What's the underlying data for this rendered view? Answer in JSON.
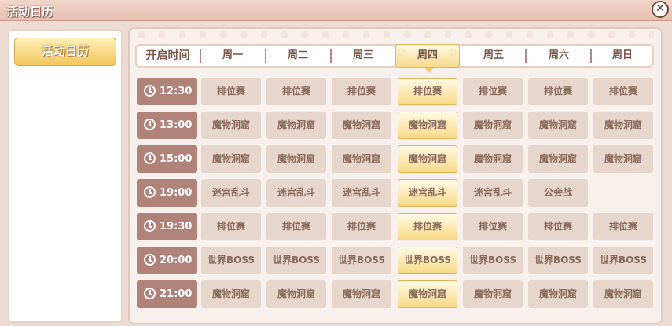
{
  "window": {
    "title": "活动日历",
    "close_symbol": "✕"
  },
  "sidebar": {
    "items": [
      {
        "label": "活动日历",
        "active": true
      }
    ]
  },
  "header": {
    "time_label": "开启时间",
    "days": [
      "周一",
      "周二",
      "周三",
      "周四",
      "周五",
      "周六",
      "周日"
    ],
    "active_day_index": 3
  },
  "schedule": [
    {
      "time": "12:30",
      "events": [
        "排位赛",
        "排位赛",
        "排位赛",
        "排位赛",
        "排位赛",
        "排位赛",
        "排位赛"
      ]
    },
    {
      "time": "13:00",
      "events": [
        "魔物洞窟",
        "魔物洞窟",
        "魔物洞窟",
        "魔物洞窟",
        "魔物洞窟",
        "魔物洞窟",
        "魔物洞窟"
      ]
    },
    {
      "time": "15:00",
      "events": [
        "魔物洞窟",
        "魔物洞窟",
        "魔物洞窟",
        "魔物洞窟",
        "魔物洞窟",
        "魔物洞窟",
        "魔物洞窟"
      ]
    },
    {
      "time": "19:00",
      "events": [
        "迷宫乱斗",
        "迷宫乱斗",
        "迷宫乱斗",
        "迷宫乱斗",
        "迷宫乱斗",
        "公会战",
        ""
      ]
    },
    {
      "time": "19:30",
      "events": [
        "排位赛",
        "排位赛",
        "排位赛",
        "排位赛",
        "排位赛",
        "排位赛",
        "排位赛"
      ]
    },
    {
      "time": "20:00",
      "events": [
        "世界BOSS",
        "世界BOSS",
        "世界BOSS",
        "世界BOSS",
        "世界BOSS",
        "世界BOSS",
        "世界BOSS"
      ]
    },
    {
      "time": "21:00",
      "events": [
        "魔物洞窟",
        "魔物洞窟",
        "魔物洞窟",
        "魔物洞窟",
        "魔物洞窟",
        "魔物洞窟",
        "魔物洞窟"
      ]
    }
  ],
  "colors": {
    "accent": "#f8d988",
    "time_bg": "#b0837a",
    "cell_bg": "#e6d6cb",
    "text": "#8a6a5c"
  }
}
